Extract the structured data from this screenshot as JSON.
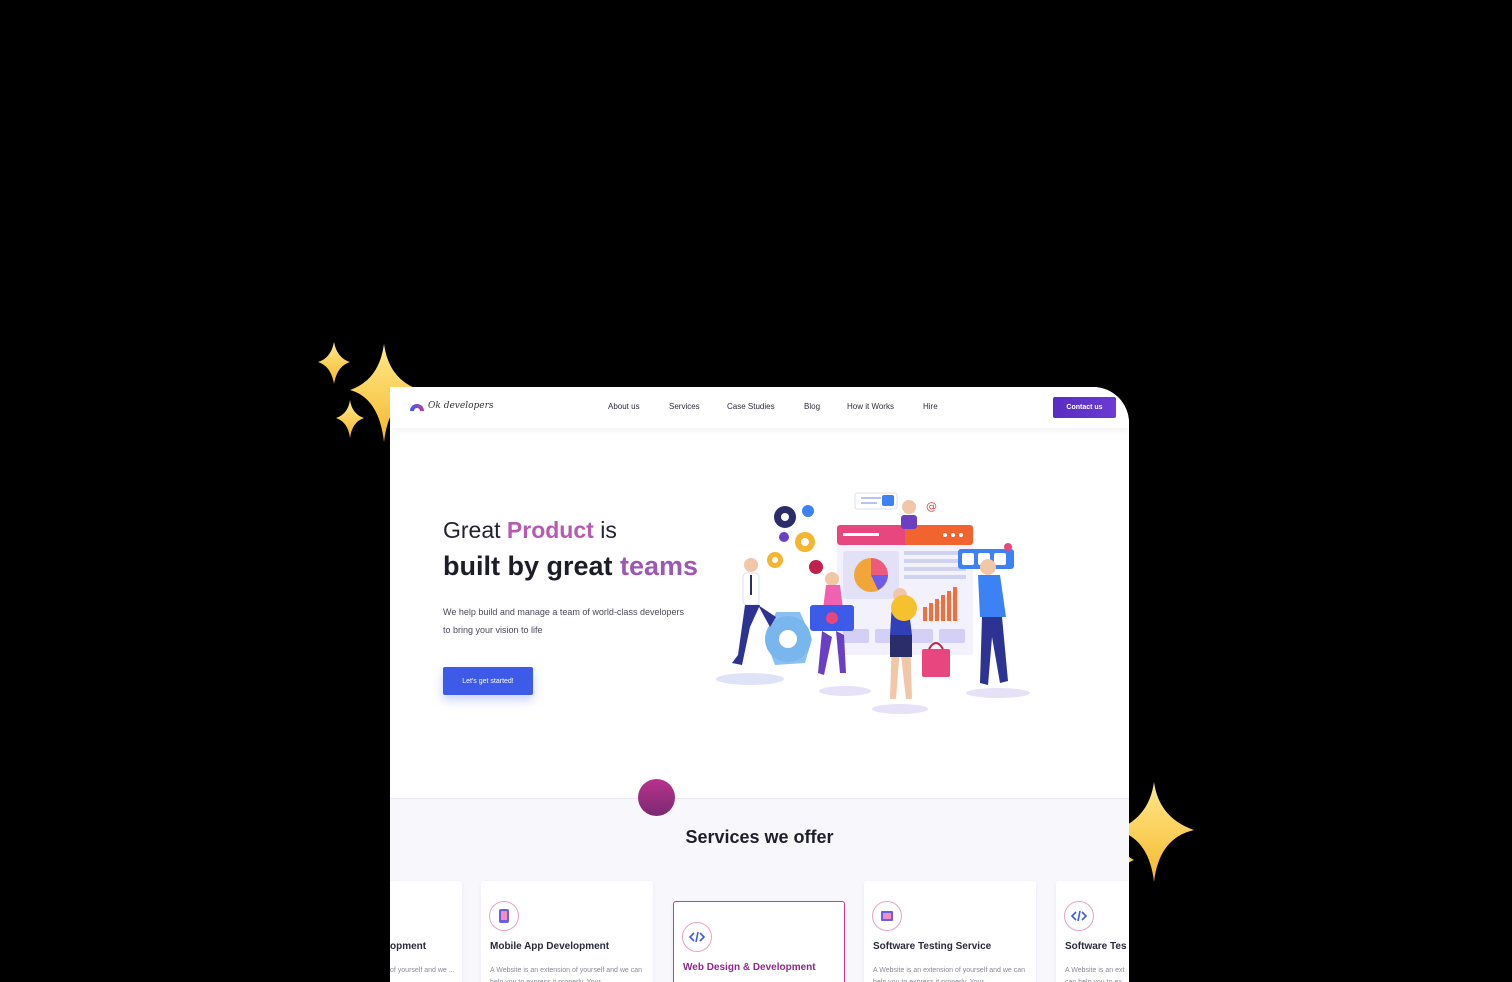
{
  "nav": {
    "logo_text": "Ok developers",
    "links": [
      "About us",
      "Services",
      "Case Studies",
      "Blog",
      "How it Works",
      "Hire"
    ],
    "contact_label": "Contact us"
  },
  "hero": {
    "line1_pre": "Great ",
    "line1_accent": "Product",
    "line1_post": " is",
    "line2_pre": "built by great ",
    "line2_accent": "teams",
    "desc_line1": "We help build and manage a team of world-class developers",
    "desc_line2": "to bring your vision to life",
    "cta_label": "Let's get started!"
  },
  "services": {
    "title": "Services we offer",
    "cards": [
      {
        "title": "opment",
        "desc": "of yourself and we ... properly. Your",
        "icon": "code-icon"
      },
      {
        "title": "Mobile App Development",
        "desc": "A Website is an extension of yourself and we can help you to express it properly. Your",
        "icon": "mobile-icon"
      },
      {
        "title": "Web Design & Development",
        "desc": "",
        "icon": "code-icon"
      },
      {
        "title": "Software Testing Service",
        "desc": "A Website is an extension of yourself and we can help you to express it properly. Your",
        "icon": "testing-icon"
      },
      {
        "title": "Software Tes",
        "desc": "A Website is an ext can help you to ex",
        "icon": "code-icon"
      }
    ]
  },
  "colors": {
    "accent_pink": "#b65ab3",
    "accent_purple": "#9b59b6",
    "cta_blue": "#3d5be8",
    "contact_purple": "#5b2cc1"
  }
}
